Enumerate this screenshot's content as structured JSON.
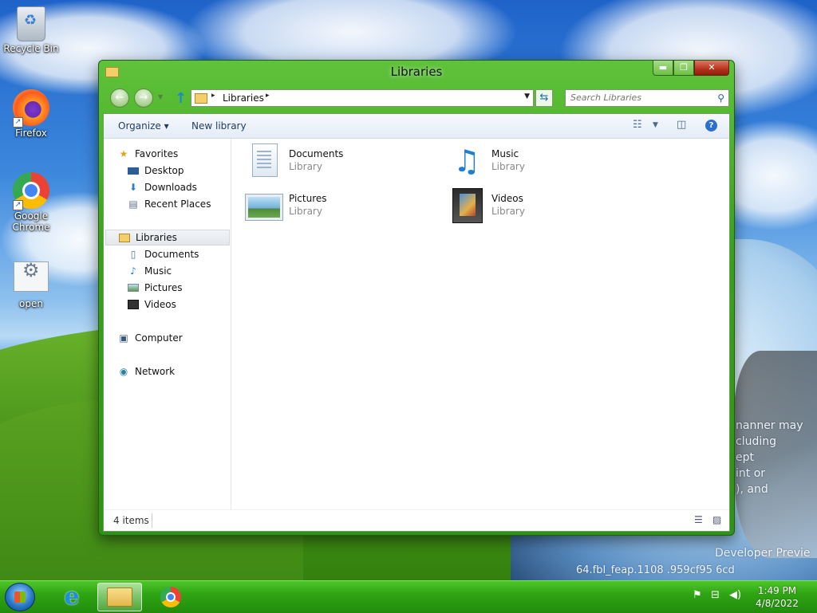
{
  "desktop": {
    "icons": [
      {
        "label": "Recycle Bin"
      },
      {
        "label": "Firefox"
      },
      {
        "label": "Google Chrome"
      },
      {
        "label": "open"
      }
    ],
    "wallpaper_text": [
      "nanner may",
      "cluding",
      "ept",
      "int or",
      "), and",
      "Developer Previe",
      "64.fbl_feap.1108 .959cf95 6cd"
    ]
  },
  "window": {
    "title": "Libraries",
    "caption_buttons": {
      "minimize": "▬",
      "maximize": "❐",
      "close": "✕"
    },
    "address": {
      "path": "Libraries",
      "separator": "▸"
    },
    "search": {
      "placeholder": "Search Libraries",
      "value": ""
    },
    "toolbar": {
      "organize": "Organize",
      "organize_arrow": "▾",
      "new_library": "New library",
      "help": "?"
    },
    "nav": {
      "favorites": "Favorites",
      "desktop": "Desktop",
      "downloads": "Downloads",
      "recent_places": "Recent Places",
      "libraries": "Libraries",
      "documents": "Documents",
      "music": "Music",
      "pictures": "Pictures",
      "videos": "Videos",
      "computer": "Computer",
      "network": "Network"
    },
    "libraries": [
      {
        "name": "Documents",
        "type": "Library"
      },
      {
        "name": "Music",
        "type": "Library"
      },
      {
        "name": "Pictures",
        "type": "Library"
      },
      {
        "name": "Videos",
        "type": "Library"
      }
    ],
    "status": {
      "items": "4 items"
    }
  },
  "taskbar": {
    "clock": {
      "time": "1:49 PM",
      "date": "4/8/2022"
    }
  },
  "colors": {
    "window_frame": "#3aa11c",
    "taskbar": "#2fa514",
    "accent_blue": "#1e7fd0"
  }
}
